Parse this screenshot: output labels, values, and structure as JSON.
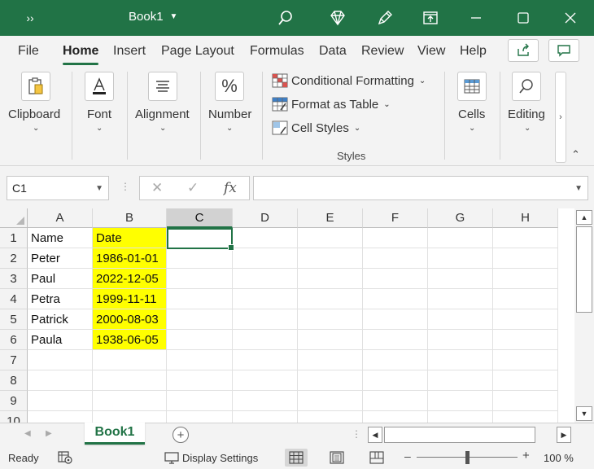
{
  "window": {
    "title": "Book1"
  },
  "ribbon_tabs": [
    {
      "label": "File"
    },
    {
      "label": "Home"
    },
    {
      "label": "Insert"
    },
    {
      "label": "Page Layout"
    },
    {
      "label": "Formulas"
    },
    {
      "label": "Data"
    },
    {
      "label": "Review"
    },
    {
      "label": "View"
    },
    {
      "label": "Help"
    }
  ],
  "ribbon": {
    "clipboard": "Clipboard",
    "font": "Font",
    "alignment": "Alignment",
    "number": "Number",
    "conditional_formatting": "Conditional Formatting",
    "format_as_table": "Format as Table",
    "cell_styles": "Cell Styles",
    "styles_group": "Styles",
    "cells": "Cells",
    "editing": "Editing"
  },
  "formula_bar": {
    "name_box": "C1",
    "formula": ""
  },
  "columns": [
    "A",
    "B",
    "C",
    "D",
    "E",
    "F",
    "G",
    "H"
  ],
  "rows": [
    "1",
    "2",
    "3",
    "4",
    "5",
    "6",
    "7",
    "8",
    "9",
    "10"
  ],
  "cells": {
    "A1": "Name",
    "B1": "Date",
    "A2": "Peter",
    "B2": "1986-01-01",
    "A3": "Paul",
    "B3": "2022-12-05",
    "A4": "Petra",
    "B4": "1999-11-11",
    "A5": "Patrick",
    "B5": "2000-08-03",
    "A6": "Paula",
    "B6": "1938-06-05"
  },
  "selected_cell": "C1",
  "highlight_color": "#ffff00",
  "accent_color": "#217346",
  "sheet_tabs": [
    {
      "label": "Book1"
    }
  ],
  "status": {
    "ready": "Ready",
    "display_settings": "Display Settings",
    "zoom": "100 %"
  }
}
